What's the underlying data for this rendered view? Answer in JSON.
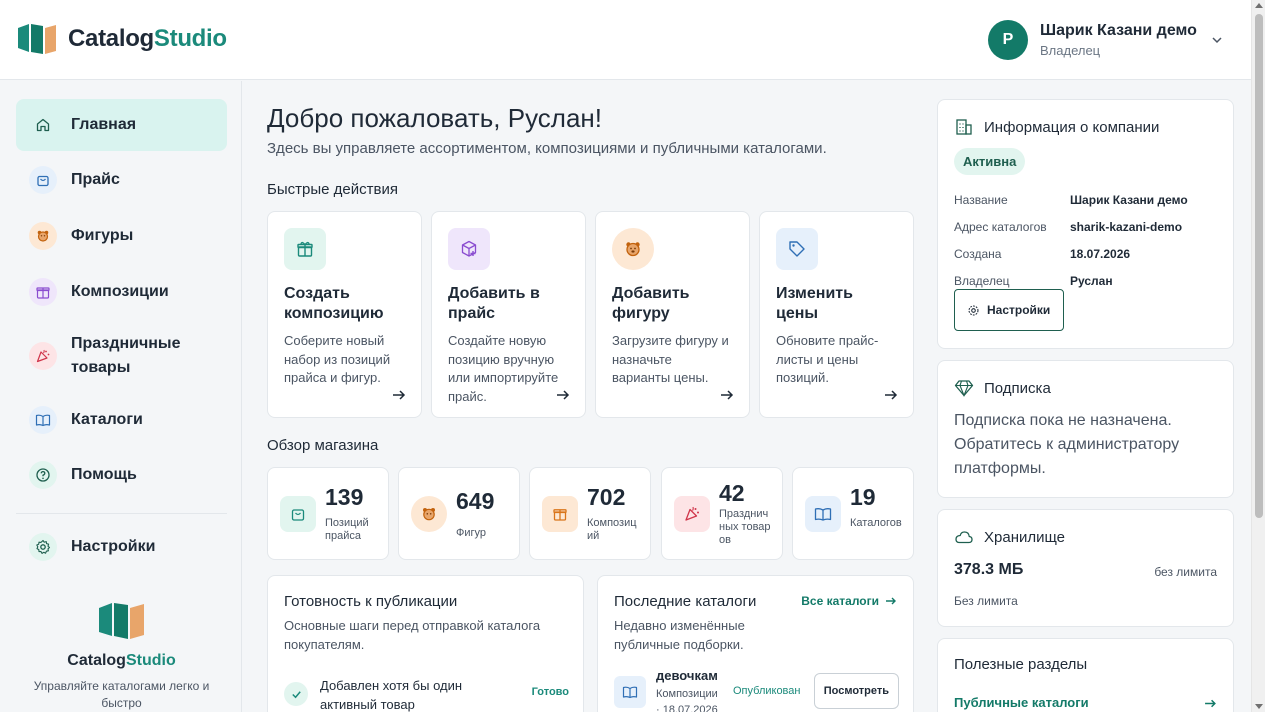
{
  "app": {
    "brand_part1": "Catalog",
    "brand_part2": "Studio",
    "tagline": "Управляйте каталогами легко и быстро"
  },
  "user": {
    "initial": "Р",
    "name": "Шарик Казани демо",
    "role": "Владелец"
  },
  "sidebar": {
    "items": [
      {
        "label": "Главная",
        "icon": "home-icon"
      },
      {
        "label": "Прайс",
        "icon": "shopping-bag-icon"
      },
      {
        "label": "Фигуры",
        "icon": "bear-icon"
      },
      {
        "label": "Композиции",
        "icon": "gift-icon"
      },
      {
        "label": "Праздничные товары",
        "icon": "party-popper-icon"
      },
      {
        "label": "Каталоги",
        "icon": "book-open-icon"
      },
      {
        "label": "Помощь",
        "icon": "help-circle-icon"
      },
      {
        "label": "Настройки",
        "icon": "gear-icon"
      }
    ]
  },
  "main": {
    "title": "Добро пожаловать, Руслан!",
    "subtitle": "Здесь вы управляете ассортиментом, композициями и публичными каталогами.",
    "quick_actions_title": "Быстрые действия",
    "quick_actions": [
      {
        "title": "Создать композицию",
        "desc": "Соберите новый набор из позиций прайса и фигур.",
        "icon": "gift-icon"
      },
      {
        "title": "Добавить в прайс",
        "desc": "Создайте новую позицию вручную или импортируйте прайс.",
        "icon": "box-plus-icon"
      },
      {
        "title": "Добавить фигуру",
        "desc": "Загрузите фигуру и назначьте варианты цены.",
        "icon": "bear-icon"
      },
      {
        "title": "Изменить цены",
        "desc": "Обновите прайс-листы и цены позиций.",
        "icon": "tag-icon"
      }
    ],
    "overview_title": "Обзор магазина",
    "stats": [
      {
        "value": "139",
        "label": "Позиций прайса",
        "icon": "shopping-bag-icon"
      },
      {
        "value": "649",
        "label": "Фигур",
        "icon": "bear-icon"
      },
      {
        "value": "702",
        "label": "Композиций",
        "icon": "gift-icon"
      },
      {
        "value": "42",
        "label": "Праздничных товаров",
        "icon": "party-popper-icon"
      },
      {
        "value": "19",
        "label": "Каталогов",
        "icon": "book-open-icon"
      }
    ],
    "readiness": {
      "title": "Готовность к публикации",
      "subtitle": "Основные шаги перед отправкой каталога покупателям.",
      "items": [
        {
          "text": "Добавлен хотя бы один активный товар",
          "status": "Готово"
        }
      ]
    },
    "recent": {
      "title": "Последние каталоги",
      "subtitle": "Недавно изменённые публичные подборки.",
      "all_label": "Все каталоги",
      "items": [
        {
          "name": "девочкам",
          "meta": "Композиции · 18.07.2026",
          "status": "Опубликован",
          "action": "Посмотреть"
        }
      ]
    }
  },
  "company": {
    "title": "Информация о компании",
    "status": "Активна",
    "fields": [
      {
        "label": "Название",
        "value": "Шарик Казани демо"
      },
      {
        "label": "Адрес каталогов",
        "value": "sharik-kazani-demo"
      },
      {
        "label": "Создана",
        "value": "18.07.2026"
      },
      {
        "label": "Владелец",
        "value": "Руслан"
      }
    ],
    "settings_label": "Настройки"
  },
  "subscription": {
    "title": "Подписка",
    "text": "Подписка пока не назначена. Обратитесь к администратору платформы."
  },
  "storage": {
    "title": "Хранилище",
    "value": "378.3 МБ",
    "limit": "без лимита",
    "sub": "Без лимита"
  },
  "useful": {
    "title": "Полезные разделы",
    "links": [
      {
        "label": "Публичные каталоги"
      }
    ]
  },
  "colors": {
    "accent": "#1b8a7b",
    "accent_dark": "#137a68",
    "active_bg": "#d9f3ef",
    "logo_orange": "#e8a56a"
  }
}
